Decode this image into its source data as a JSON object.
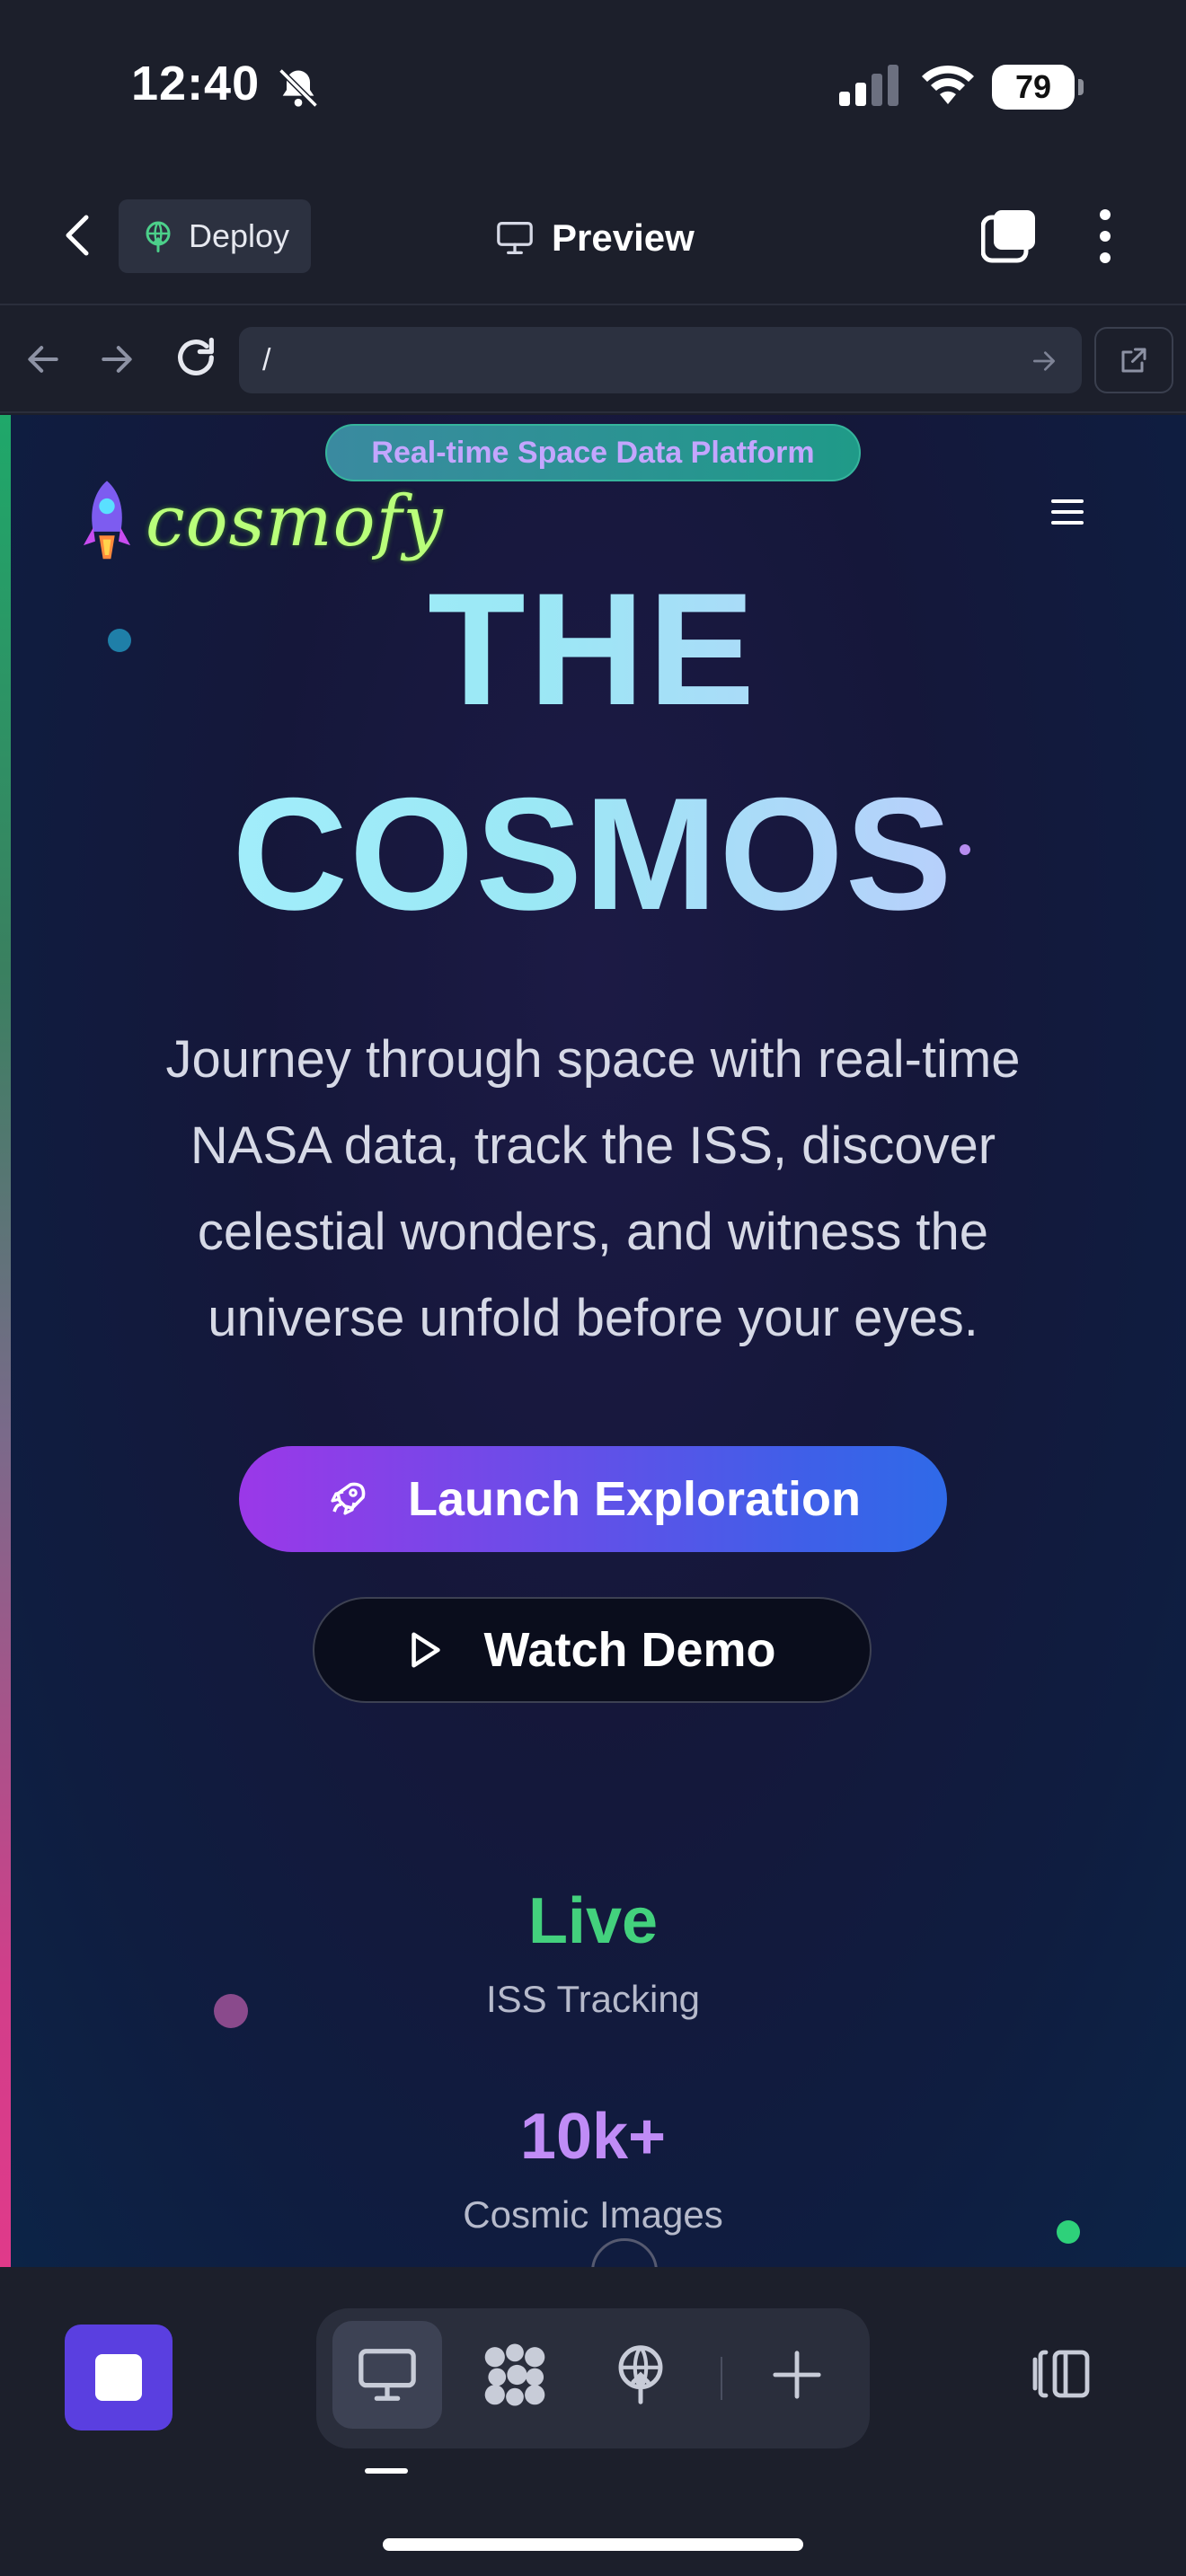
{
  "status_bar": {
    "time": "12:40",
    "battery": "79",
    "icons": [
      "bell-slash-icon",
      "signal-icon",
      "wifi-icon",
      "battery-icon"
    ]
  },
  "app_toolbar": {
    "deploy_label": "Deploy",
    "preview_label": "Preview",
    "icons": [
      "back-icon",
      "deploy-icon",
      "monitor-icon",
      "tabs-icon",
      "more-vertical-icon"
    ]
  },
  "url_bar": {
    "value": "/",
    "icons": [
      "arrow-left-icon",
      "arrow-right-icon",
      "reload-icon",
      "go-icon",
      "open-external-icon"
    ]
  },
  "site": {
    "badge": "Real-time Space Data Platform",
    "logo_text": "cosmofy",
    "hero_line1": "THE",
    "hero_line2": "COSMOS",
    "subtitle_lines": [
      "Journey through space with real-time",
      "NASA data, track the ISS, discover",
      "celestial wonders, and witness the",
      "universe unfold before your eyes."
    ],
    "primary_cta": "Launch Exploration",
    "secondary_cta": "Watch Demo",
    "stats": [
      {
        "value": "Live",
        "label": "ISS Tracking",
        "color": "#43d17d"
      },
      {
        "value": "10k+",
        "label": "Cosmic Images",
        "color": "#c08cf6"
      }
    ],
    "accent_colors": {
      "primary_gradient_start": "#9b38e8",
      "primary_gradient_end": "#2f6ae8",
      "badge": "#1f9a88"
    }
  },
  "bottom_bar": {
    "icons": [
      "stop-icon",
      "monitor-icon",
      "apps-icon",
      "deploy-icon",
      "plus-icon",
      "layout-icon"
    ],
    "active_tab": "monitor"
  }
}
